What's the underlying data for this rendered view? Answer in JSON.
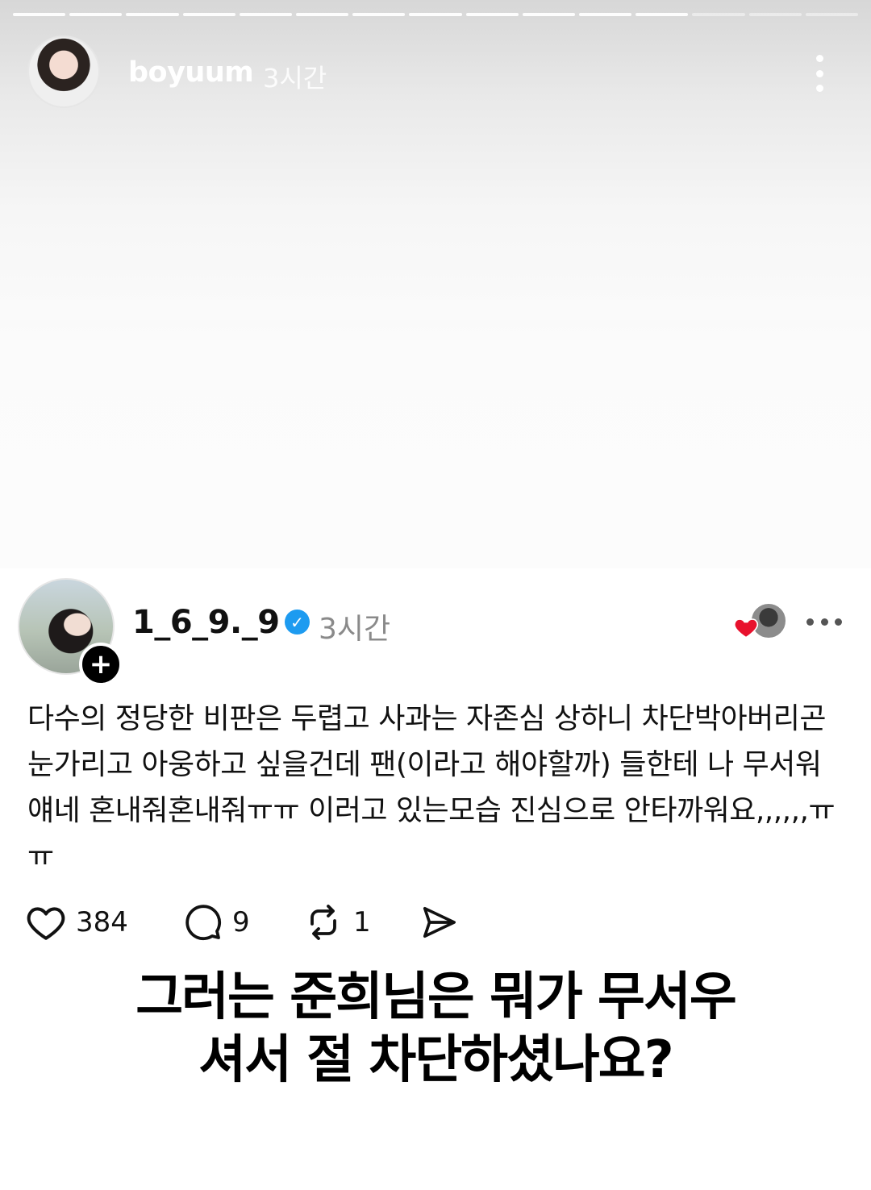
{
  "story": {
    "username": "boyuum",
    "time": "3시간",
    "progress_segments": 15,
    "progress_active_index": 11,
    "icons": {
      "menu": "vertical-ellipsis-icon"
    }
  },
  "post": {
    "username": "1_6_9._9",
    "verified": true,
    "time": "3시간",
    "follow_symbol": "+",
    "text": "다수의 정당한 비판은 두렵고 사과는 자존심 상하니 차단박아버리곤 눈가리고 아웅하고 싶을건데 팬(이라고 해야할까) 들한테 나 무서워 얘네 혼내줘혼내줘ㅠㅠ 이러고 있는모습 진심으로 안타까워요,,,,,,ㅠㅠ",
    "likes": "384",
    "comments": "9",
    "reposts": "1",
    "icons": {
      "verified": "verified-check-icon",
      "liked_by": "heart-icon",
      "more": "horizontal-ellipsis-icon",
      "like": "heart-outline-icon",
      "comment": "speech-bubble-icon",
      "repost": "repost-arrows-icon",
      "share": "paper-plane-icon"
    },
    "colors": {
      "verified": "#1d9bf0",
      "heart": "#e8112d"
    }
  },
  "caption": {
    "line1": "그러는 준희님은 뭐가 무서우",
    "line2": "셔서 절 차단하셨나요?"
  }
}
